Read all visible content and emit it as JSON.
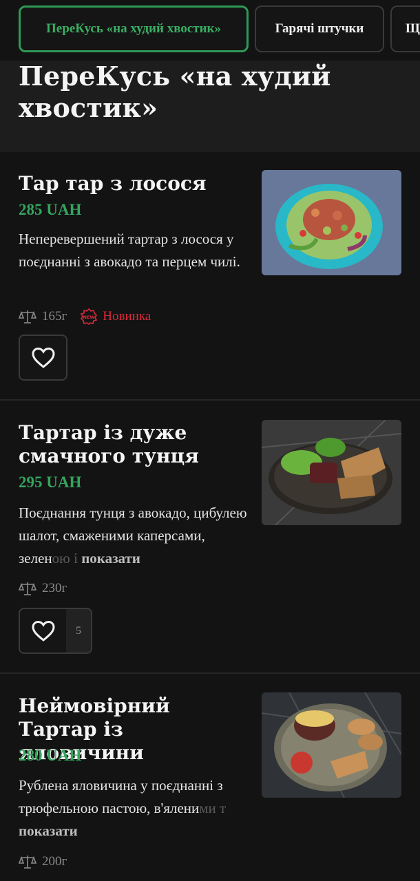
{
  "tabs": [
    {
      "label": "ПереКусь «на худий хвостик»",
      "active": true
    },
    {
      "label": "Гарячі штучки",
      "active": false
    },
    {
      "label": "Щ",
      "active": false
    }
  ],
  "section": {
    "title": "ПереКусь «на худий хвостик»"
  },
  "items": [
    {
      "name": "Тар тар з лосося",
      "price": "285 UAH",
      "description": "Неперевершений тартар з лосося у поєднанні з авокадо та перцем чилі.",
      "weight": "165г",
      "badge": "Новинка",
      "badge_icon_text": "NEW",
      "likes": ""
    },
    {
      "name": "Тартар із дуже смачного тунця",
      "price": "295 UAH",
      "description_visible": "Поєднання тунця з авокадо, цибулею шалот, смаженими каперсами, зелен",
      "description_faded": "ою і",
      "more": "показати",
      "weight": "230г",
      "likes": "5"
    },
    {
      "name": "Неймовірний Тартар із яловичини",
      "price": "280 UAH",
      "description_visible": "Рублена яловичина у поєднанні з трюфельною пастою, в'ялени",
      "description_faded": "ми т",
      "more": "показати",
      "weight": "200г"
    }
  ],
  "colors": {
    "accent": "#35a45e",
    "new": "#d72b3a",
    "background": "#131313"
  },
  "icons": {
    "weight": "scale-icon",
    "favorite": "heart-icon",
    "new": "new-badge-icon"
  }
}
